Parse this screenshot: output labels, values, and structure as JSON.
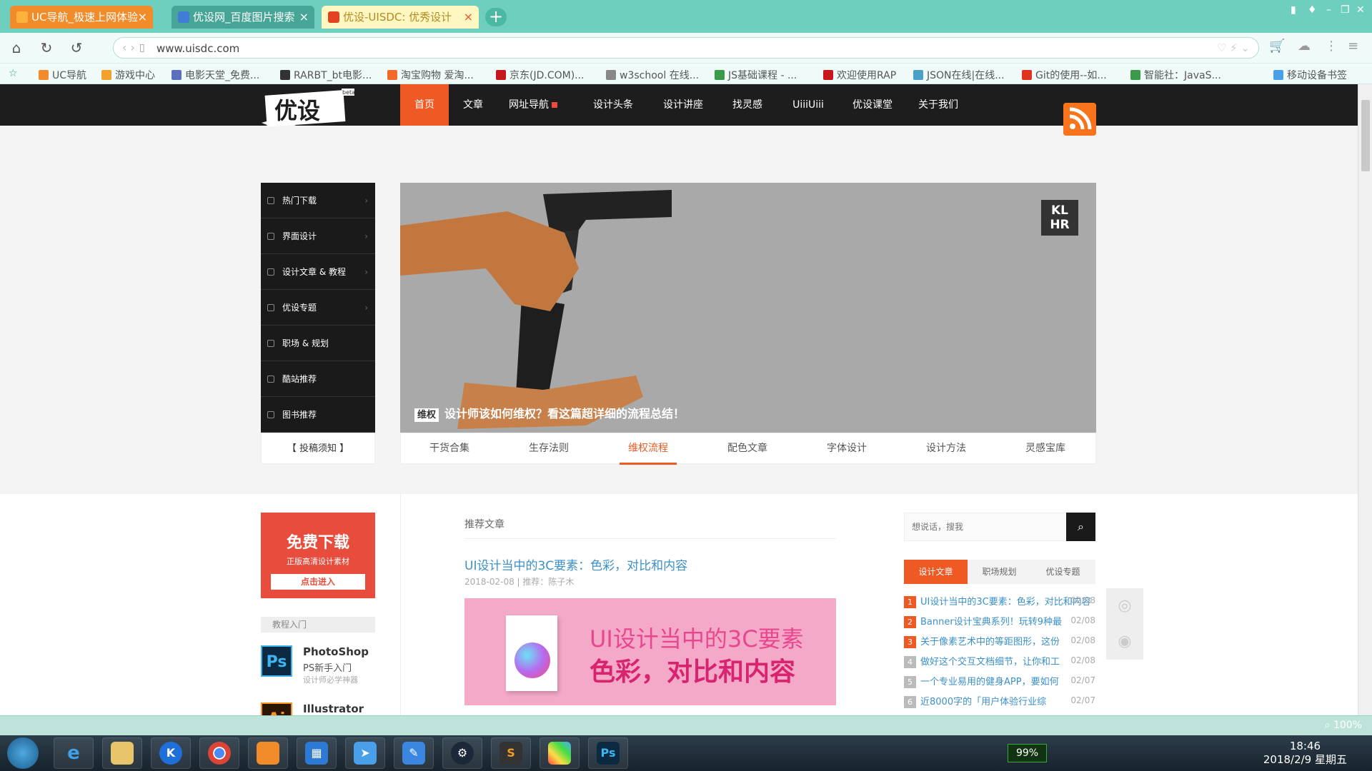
{
  "tabs": [
    {
      "title": "UC导航_极速上网体验",
      "active": false
    },
    {
      "title": "优设网_百度图片搜索",
      "active": false
    },
    {
      "title": "优设-UISDC: 优秀设计",
      "active": true
    }
  ],
  "address": {
    "url": "www.uisdc.com"
  },
  "bookmarks": [
    "UC导航",
    "游戏中心",
    "电影天堂_免费...",
    "RARBT_bt电影...",
    "淘宝购物 爱淘...",
    "京东(JD.COM)...",
    "w3school 在线...",
    "JS基础课程 - ...",
    "欢迎使用RAP",
    "JSON在线|在线...",
    "Git的使用--如...",
    "智能社：JavaS...",
    "移动设备书签"
  ],
  "nav": {
    "logo": "优设",
    "beta": "beta",
    "items": [
      "首页",
      "文章",
      "网址导航",
      "设计头条",
      "设计讲座",
      "找灵感",
      "UiiiUiii",
      "优设课堂",
      "关于我们"
    ],
    "active": 0
  },
  "categories": [
    "热门下载",
    "界面设计",
    "设计文章 & 教程",
    "优设专题",
    "职场 & 规划",
    "酷站推荐",
    "图书推荐"
  ],
  "submit_note": "【 投稿须知 】",
  "banner": {
    "tag": "维权",
    "caption": "设计师该如何维权？看这篇超详细的流程总结！",
    "corner_logo": "KL HR"
  },
  "subtabs": {
    "items": [
      "干货合集",
      "生存法则",
      "维权流程",
      "配色文章",
      "字体设计",
      "设计方法",
      "灵感宝库"
    ],
    "active": 2
  },
  "ad": {
    "title": "免费下载",
    "subtitle": "正版高清设计素材",
    "button": "点击进入"
  },
  "tutorials": {
    "label": "教程入门",
    "items": [
      {
        "icon": "Ps",
        "name": "PhotoShop",
        "desc": "PS新手入门",
        "sub": "设计师必学神器"
      },
      {
        "icon": "Ai",
        "name": "Illustrator",
        "desc": "",
        "sub": ""
      }
    ]
  },
  "recommend": {
    "label": "推荐文章",
    "title": "UI设计当中的3C要素：色彩，对比和内容",
    "meta": "2018-02-08 | 推荐：陈子木",
    "image_line1": "UI设计当中的3C要素",
    "image_line2": "色彩，对比和内容"
  },
  "search": {
    "placeholder": "想说话，搜我"
  },
  "rank_tabs": {
    "items": [
      "设计文章",
      "职场规划",
      "优设专题"
    ],
    "active": 0
  },
  "rank_list": [
    {
      "n": "1",
      "title": "UI设计当中的3C要素：色彩，对比和内容",
      "date": "02/08"
    },
    {
      "n": "2",
      "title": "Banner设计宝典系列！玩转9种最",
      "date": "02/08"
    },
    {
      "n": "3",
      "title": "关于像素艺术中的等距图形，这份",
      "date": "02/08"
    },
    {
      "n": "4",
      "title": "做好这个交互文档细节，让你和工",
      "date": "02/08"
    },
    {
      "n": "5",
      "title": "一个专业易用的健身APP，要如何",
      "date": "02/07"
    },
    {
      "n": "6",
      "title": "近8000字的「用户体验行业综",
      "date": "02/07"
    }
  ],
  "status": {
    "zoom": "100%"
  },
  "taskbar": {
    "battery": "99%",
    "time": "18:46",
    "date": "2018/2/9 星期五"
  }
}
